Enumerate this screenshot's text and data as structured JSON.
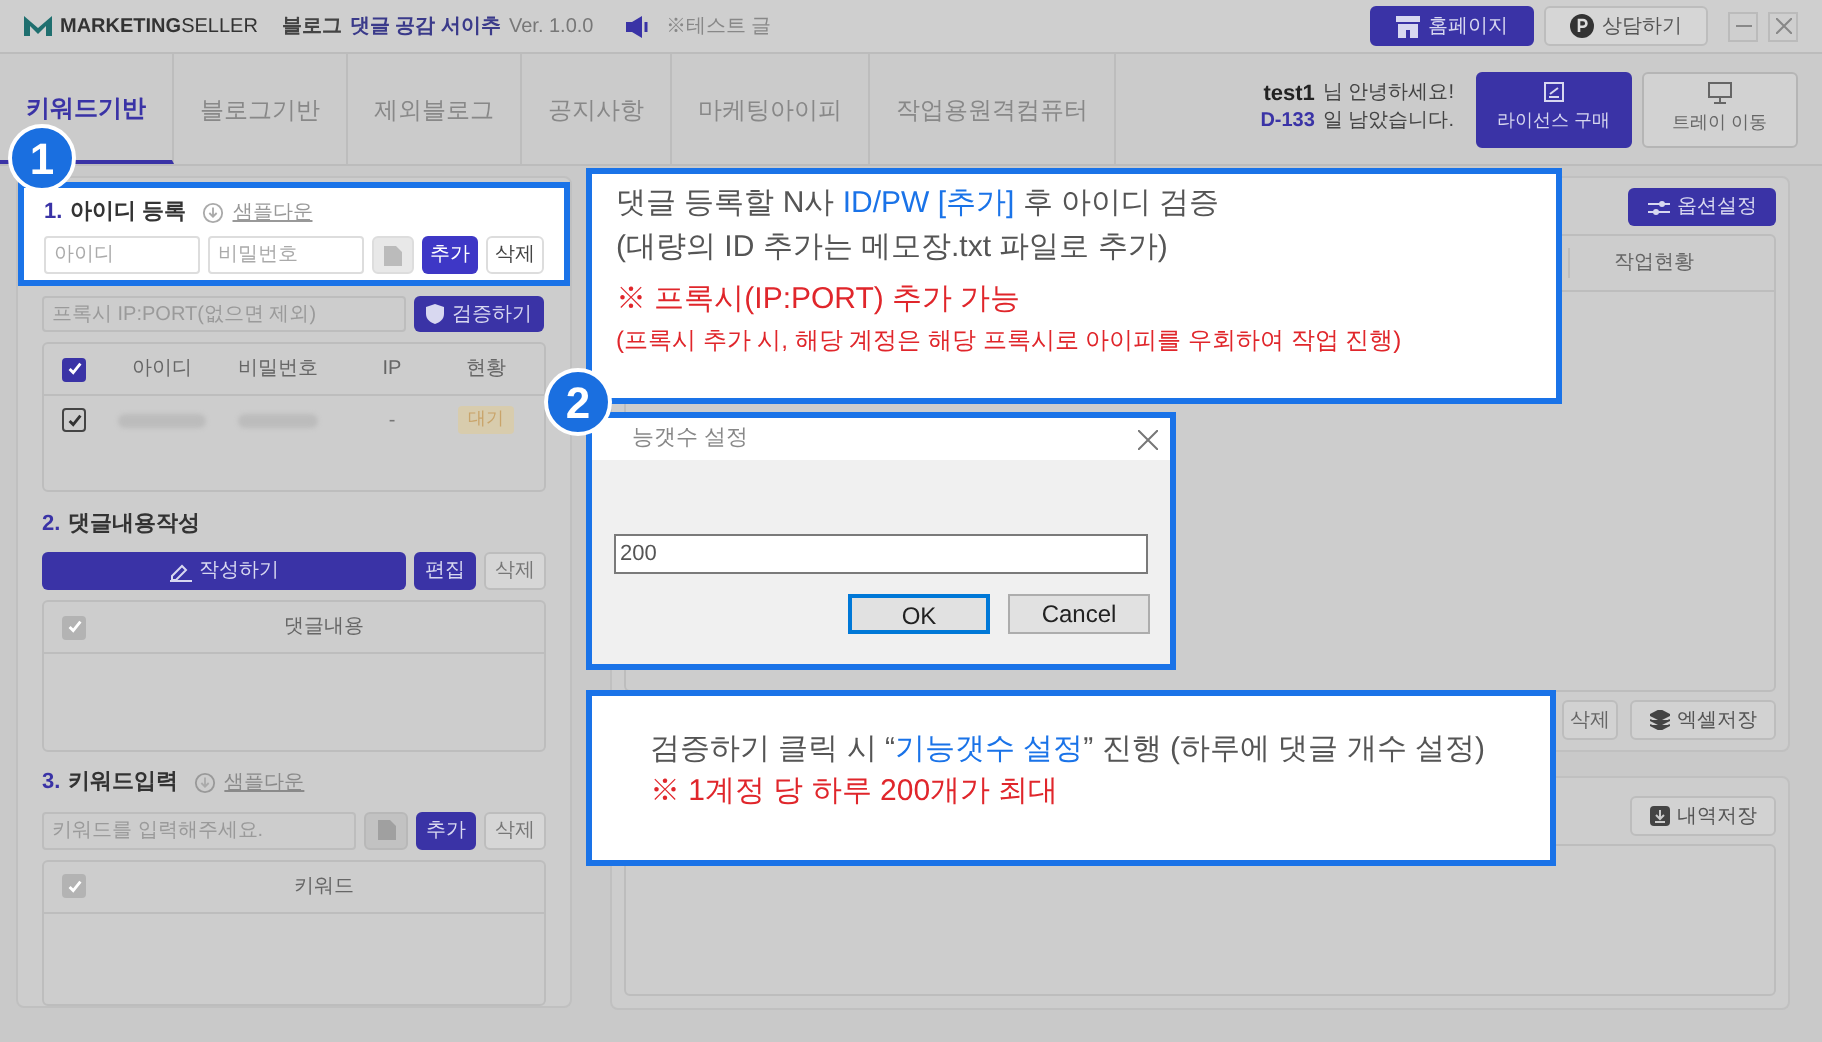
{
  "title_bar": {
    "brand": "**MARKETING**SELLER",
    "app_prefix": "블로그",
    "app_name": "댓글 공감 서이추",
    "version": "Ver. 1.0.0",
    "notice": "※테스트 글",
    "buttons": [
      {
        "label": "홈페이지",
        "kind": "primary"
      },
      {
        "label": "상담하기",
        "kind": "secondary"
      }
    ]
  },
  "tabs": [
    {
      "label": "키워드기반",
      "selected": true
    },
    {
      "label": "블로그기반",
      "selected": false
    },
    {
      "label": "제외블로그",
      "selected": false
    },
    {
      "label": "공지사항",
      "selected": false
    },
    {
      "label": "마케팅아이피",
      "selected": false
    },
    {
      "label": "작업용원격컴퓨터",
      "selected": false
    }
  ],
  "user": {
    "name": "test1",
    "greeting": "님 안녕하세요!",
    "days": "D-133",
    "days_suffix": "일 남았습니다.",
    "buttons": [
      {
        "label": "라이선스 구매",
        "kind": "primary"
      },
      {
        "label": "트레이 이동",
        "kind": "secondary"
      }
    ]
  },
  "section_account": {
    "number": "1.",
    "title": "아이디 등록",
    "sample_link": "샘플다운",
    "id_placeholder": "아이디",
    "pw_placeholder": "비밀번호",
    "add": "추가",
    "delete": "삭제",
    "proxy_placeholder": "프록시 IP:PORT(없으면 제외)",
    "verify": "검증하기",
    "header_checked": true,
    "columns": [
      "아이디",
      "비밀번호",
      "IP",
      "현황"
    ],
    "rows": [
      {
        "checked": true,
        "ip": "-",
        "status": "대기"
      }
    ]
  },
  "section_comment": {
    "number": "2.",
    "title": "댓글내용작성",
    "write": "작성하기",
    "edit": "편집",
    "delete": "삭제",
    "header_checked": true,
    "columns": [
      "댓글내용"
    ]
  },
  "section_keyword": {
    "number": "3.",
    "title": "키워드입력",
    "sample_link": "샘플다운",
    "placeholder": "키워드를 입력해주세요.",
    "add": "추가",
    "delete": "삭제",
    "header_checked": true,
    "columns": [
      "키워드"
    ]
  },
  "work_panel": {
    "options": "옵션설정",
    "columns": [
      "작업현황"
    ],
    "delete": "삭제",
    "excel": "엑셀저장"
  },
  "log_panel": {
    "save": "내역저장"
  },
  "callouts": [
    {
      "badge": "1",
      "lines": [
        {
          "kind": "main",
          "segments": [
            {
              "text": "댓글 등록할 N사 ",
              "highlight": false
            },
            {
              "text": "ID/PW [추가]",
              "highlight": true
            },
            {
              "text": " 후 아이디 검증",
              "highlight": false
            }
          ]
        },
        {
          "kind": "main",
          "segments": [
            {
              "text": "(대량의 ID 추가는 메모장.txt 파일로 추가)",
              "highlight": false
            }
          ]
        },
        {
          "kind": "warning",
          "segments": [
            {
              "text": "※ 프록시(IP:PORT) 추가 가능",
              "highlight": false
            }
          ]
        },
        {
          "kind": "warning_small",
          "segments": [
            {
              "text": "(프록시 추가 시, 해당 계정은 해당 프록시로 아이피를 우회하여 작업 진행)",
              "highlight": false
            }
          ]
        }
      ]
    },
    {
      "badge": "2",
      "lines": [
        {
          "kind": "main",
          "segments": [
            {
              "text": "검증하기 클릭 시 “",
              "highlight": false
            },
            {
              "text": "기능갯수 설정",
              "highlight": true
            },
            {
              "text": "” 진행 (하루에 댓글 개수 설정)",
              "highlight": false
            }
          ]
        },
        {
          "kind": "warning",
          "segments": [
            {
              "text": "※ 1계정 당 하루 200개가 최대",
              "highlight": false
            }
          ]
        }
      ]
    }
  ],
  "dialog": {
    "title": "능갯수 설정",
    "value": "200",
    "buttons": [
      {
        "label": "OK",
        "default": true
      },
      {
        "label": "Cancel",
        "default": false
      }
    ]
  }
}
